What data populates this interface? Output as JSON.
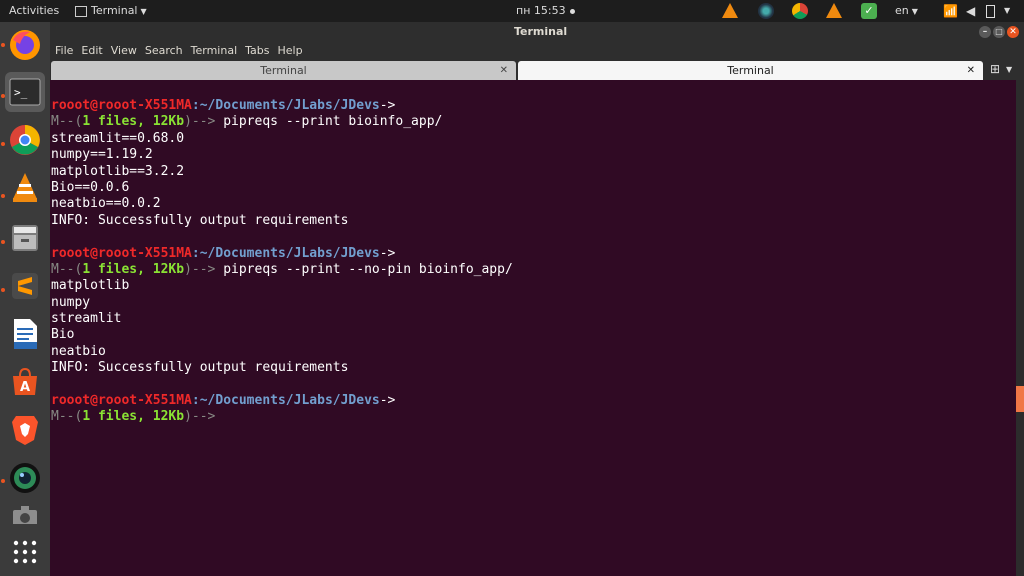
{
  "topbar": {
    "activities": "Activities",
    "app_menu": "Terminal",
    "clock": "пн 15:53",
    "lang": "en",
    "tray_icons": [
      "vlc-icon",
      "blender-icon",
      "chrome-icon",
      "vlc-icon",
      "check-icon"
    ]
  },
  "window": {
    "title": "Terminal",
    "menu": [
      "File",
      "Edit",
      "View",
      "Search",
      "Terminal",
      "Tabs",
      "Help"
    ],
    "tabs": [
      {
        "label": "Terminal",
        "active": false
      },
      {
        "label": "Terminal",
        "active": true
      }
    ]
  },
  "dock": {
    "items": [
      "firefox-icon",
      "terminal-icon",
      "chrome-icon",
      "vlc-icon",
      "files-icon",
      "sublime-icon",
      "writer-icon",
      "software-icon",
      "brave-icon",
      "camera-icon",
      "screenshot-icon",
      "app-grid-icon"
    ]
  },
  "terminal": {
    "user_host": "rooot@rooot-X551MA",
    "path": ":~/Documents/JLabs/JDevs",
    "arrow": "->",
    "status_prefix": "M--(",
    "status_info": "1 files, 12Kb",
    "status_suffix": ")-->",
    "cmd1": " pipreqs --print bioinfo_app/",
    "out1": [
      "streamlit==0.68.0",
      "numpy==1.19.2",
      "matplotlib==3.2.2",
      "Bio==0.0.6",
      "neatbio==0.0.2",
      "INFO: Successfully output requirements"
    ],
    "cmd2": " pipreqs --print --no-pin bioinfo_app/",
    "out2": [
      "matplotlib",
      "numpy",
      "streamlit",
      "Bio",
      "neatbio",
      "INFO: Successfully output requirements"
    ],
    "cmd3": ""
  },
  "colors": {
    "terminal_bg": "#300a24",
    "accent": "#e95420"
  }
}
